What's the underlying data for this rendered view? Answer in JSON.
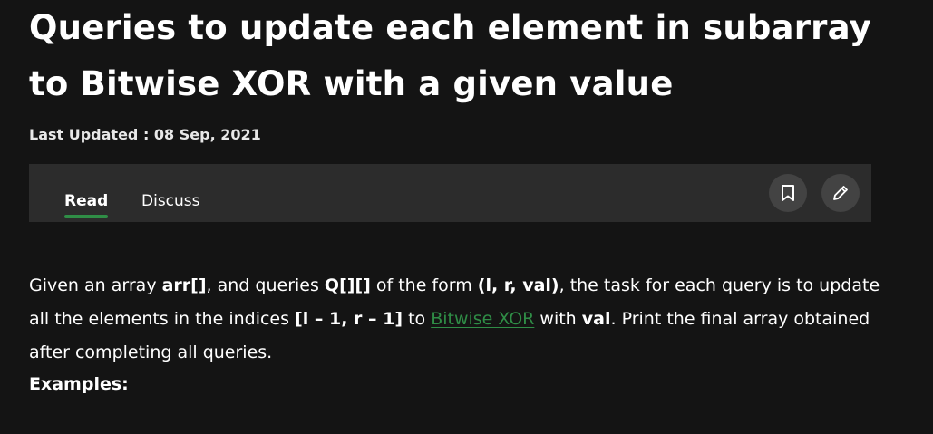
{
  "article": {
    "title": "Queries to update each element in subarray to Bitwise XOR with a given value",
    "last_updated": "Last Updated : 08 Sep, 2021"
  },
  "tabs": {
    "read_label": "Read",
    "discuss_label": "Discuss"
  },
  "actions": {
    "bookmark_icon": "bookmark-icon",
    "edit_icon": "pencil-icon"
  },
  "body": {
    "p1_t1": "Given an array ",
    "p1_b1": "arr[]",
    "p1_t2": ", and queries ",
    "p1_b2": "Q[][]",
    "p1_t3": " of the form ",
    "p1_b3": "(l, r, val)",
    "p1_t4": ", the task for each query is to update all the elements in the indices ",
    "p1_b4": "[l – 1, r – 1]",
    "p1_t5": " to ",
    "p1_link": "Bitwise XOR",
    "p1_t6": " with ",
    "p1_b5": "val",
    "p1_t7": ". Print the final array obtained after completing all queries.",
    "examples_label": "Examples:"
  },
  "colors": {
    "background": "#141414",
    "tabbar": "#2c2c2c",
    "accent_green": "#2f8d46",
    "icon_button": "#434343"
  }
}
